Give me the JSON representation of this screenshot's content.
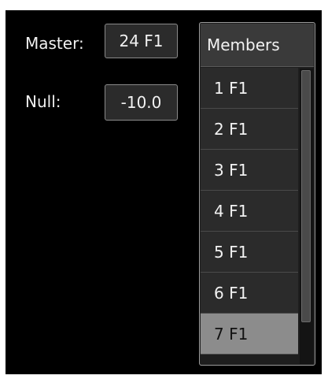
{
  "master": {
    "label": "Master:",
    "value": "24 F1"
  },
  "null": {
    "label": "Null:",
    "value": "-10.0"
  },
  "members": {
    "header": "Members",
    "items": [
      "1 F1",
      "2 F1",
      "3 F1",
      "4 F1",
      "5 F1",
      "6 F1",
      "7 F1"
    ],
    "selected_item": "7 F1"
  },
  "colors": {
    "background": "#000000",
    "box": "#2b2b2b",
    "selected": "#8c8c8c"
  }
}
